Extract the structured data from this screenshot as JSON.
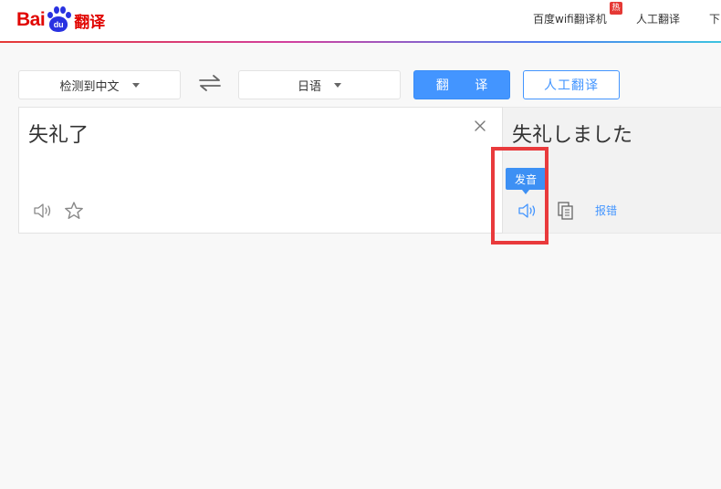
{
  "header": {
    "logo_bai": "Bai",
    "logo_du": "du",
    "logo_fanyi": "翻译",
    "nav": [
      "百度wifi翻译机",
      "人工翻译",
      "下"
    ],
    "hot_badge": "热"
  },
  "controls": {
    "source_language": "检测到中文",
    "target_language": "日语",
    "translate_button": "翻 译",
    "human_translate_button": "人工翻译"
  },
  "input": {
    "text": "失礼了"
  },
  "output": {
    "text": "失礼しました",
    "pronounce_tooltip": "发音",
    "report_link": "报错"
  },
  "colors": {
    "brand_red": "#e10602",
    "brand_blue": "#2932e1",
    "accent": "#4395ff",
    "highlight": "#e93a3c"
  },
  "icons": [
    "speaker-icon",
    "star-icon",
    "close-icon",
    "swap-icon",
    "copy-icon",
    "chevron-down-icon"
  ]
}
